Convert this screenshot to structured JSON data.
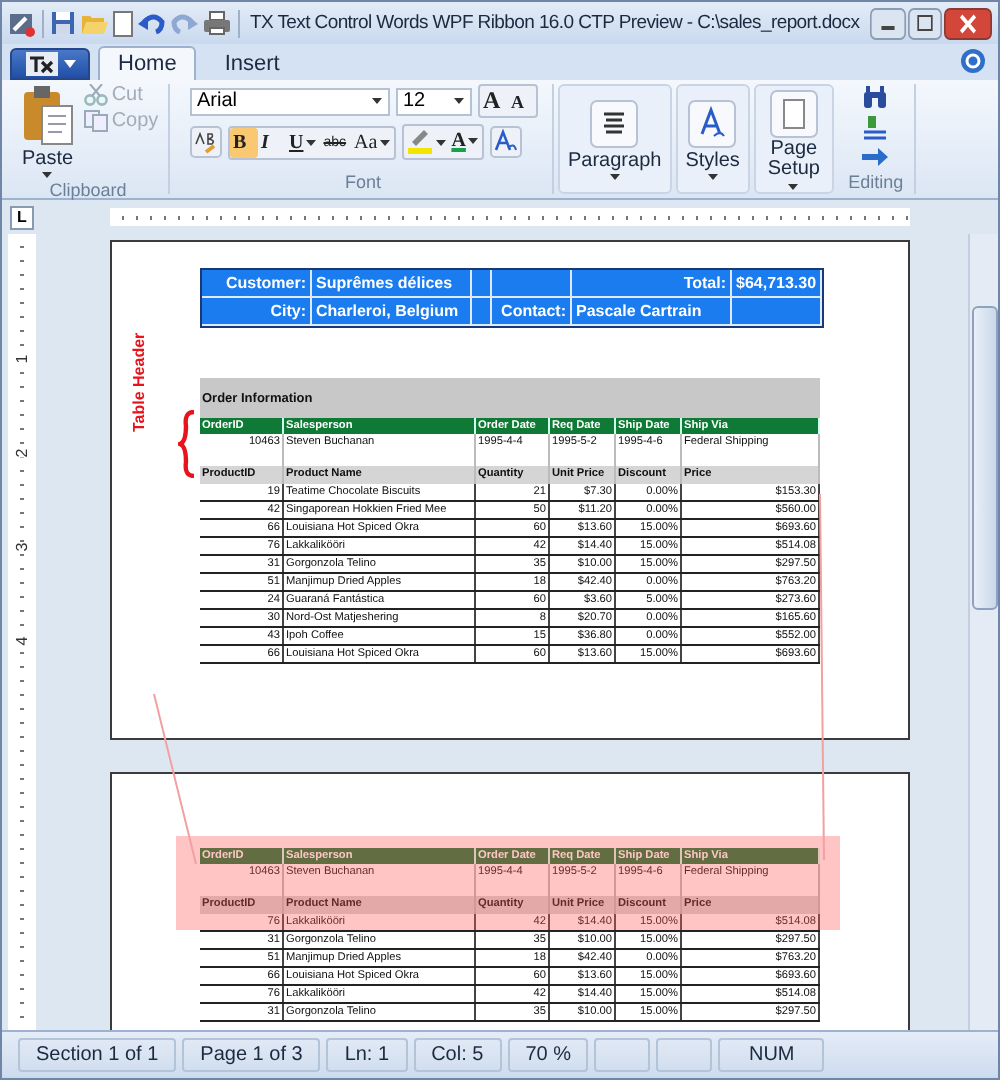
{
  "window": {
    "title": "TX Text Control Words WPF Ribbon 16.0 CTP Preview - C:\\sales_report.docx"
  },
  "tabs": [
    {
      "label": "Home",
      "selected": true
    },
    {
      "label": "Insert",
      "selected": false
    }
  ],
  "ribbon": {
    "clipboard": {
      "label": "Clipboard",
      "paste": "Paste",
      "items": [
        {
          "label": "Cut",
          "disabled": true
        },
        {
          "label": "Copy",
          "disabled": true
        }
      ]
    },
    "font": {
      "label": "Font",
      "font_name": "Arial",
      "font_size": "12",
      "size_buttons": [
        "A",
        "A"
      ],
      "font_color": "A",
      "format_buttons": [
        {
          "kind": "bold",
          "label": "B",
          "selected": true
        },
        {
          "kind": "italic",
          "label": "I",
          "selected": false
        },
        {
          "kind": "underline",
          "label": "U",
          "selected": false
        },
        {
          "kind": "strike",
          "label": "abc",
          "selected": false
        },
        {
          "kind": "case",
          "label": "Aa",
          "selected": false
        }
      ]
    },
    "paragraph": {
      "label": "Paragraph"
    },
    "styles": {
      "label": "Styles"
    },
    "page_setup": {
      "label": "Page Setup"
    },
    "editing": {
      "label": "Editing"
    }
  },
  "ruler": {
    "tab_stop": "L",
    "vertical_labels": [
      "1",
      "2",
      "3",
      "4"
    ]
  },
  "document": {
    "annotation": "Table Header",
    "pages": [
      {
        "highlighted": false,
        "customer_block": {
          "customer_label": "Customer:",
          "customer": "Suprêmes délices",
          "total_label": "Total:",
          "total": "$64,713.30",
          "city_label": "City:",
          "city": "Charleroi, Belgium",
          "contact_label": "Contact:",
          "contact": "Pascale Cartrain"
        },
        "section_title": "Order Information",
        "order_columns": [
          "OrderID",
          "Salesperson",
          "Order Date",
          "Req Date",
          "Ship Date",
          "Ship Via"
        ],
        "order_row": [
          "10463",
          "Steven Buchanan",
          "1995-4-4",
          "1995-5-2",
          "1995-4-6",
          "Federal Shipping"
        ],
        "product_columns": [
          "ProductID",
          "Product Name",
          "Quantity",
          "Unit Price",
          "Discount",
          "Price"
        ],
        "products": [
          [
            "19",
            "Teatime Chocolate Biscuits",
            "21",
            "$7.30",
            "0.00%",
            "$153.30"
          ],
          [
            "42",
            "Singaporean Hokkien Fried Mee",
            "50",
            "$11.20",
            "0.00%",
            "$560.00"
          ],
          [
            "66",
            "Louisiana Hot Spiced Okra",
            "60",
            "$13.60",
            "15.00%",
            "$693.60"
          ],
          [
            "76",
            "Lakkalikööri",
            "42",
            "$14.40",
            "15.00%",
            "$514.08"
          ],
          [
            "31",
            "Gorgonzola Telino",
            "35",
            "$10.00",
            "15.00%",
            "$297.50"
          ],
          [
            "51",
            "Manjimup Dried Apples",
            "18",
            "$42.40",
            "0.00%",
            "$763.20"
          ],
          [
            "24",
            "Guaraná Fantástica",
            "60",
            "$3.60",
            "5.00%",
            "$273.60"
          ],
          [
            "30",
            "Nord-Ost Matjeshering",
            "8",
            "$20.70",
            "0.00%",
            "$165.60"
          ],
          [
            "43",
            "Ipoh Coffee",
            "15",
            "$36.80",
            "0.00%",
            "$552.00"
          ],
          [
            "66",
            "Louisiana Hot Spiced Okra",
            "60",
            "$13.60",
            "15.00%",
            "$693.60"
          ]
        ]
      },
      {
        "highlighted": true,
        "order_columns": [
          "OrderID",
          "Salesperson",
          "Order Date",
          "Req Date",
          "Ship Date",
          "Ship Via"
        ],
        "order_row": [
          "10463",
          "Steven Buchanan",
          "1995-4-4",
          "1995-5-2",
          "1995-4-6",
          "Federal Shipping"
        ],
        "product_columns": [
          "ProductID",
          "Product Name",
          "Quantity",
          "Unit Price",
          "Discount",
          "Price"
        ],
        "products": [
          [
            "76",
            "Lakkalikööri",
            "42",
            "$14.40",
            "15.00%",
            "$514.08"
          ],
          [
            "31",
            "Gorgonzola Telino",
            "35",
            "$10.00",
            "15.00%",
            "$297.50"
          ],
          [
            "51",
            "Manjimup Dried Apples",
            "18",
            "$42.40",
            "0.00%",
            "$763.20"
          ],
          [
            "66",
            "Louisiana Hot Spiced Okra",
            "60",
            "$13.60",
            "15.00%",
            "$693.60"
          ],
          [
            "76",
            "Lakkalikööri",
            "42",
            "$14.40",
            "15.00%",
            "$514.08"
          ],
          [
            "31",
            "Gorgonzola Telino",
            "35",
            "$10.00",
            "15.00%",
            "$297.50"
          ]
        ]
      }
    ]
  },
  "status_bar": {
    "items": [
      "Section 1 of 1",
      "Page 1 of 3",
      "Ln: 1",
      "Col: 5",
      "70 %"
    ],
    "num": "NUM"
  }
}
